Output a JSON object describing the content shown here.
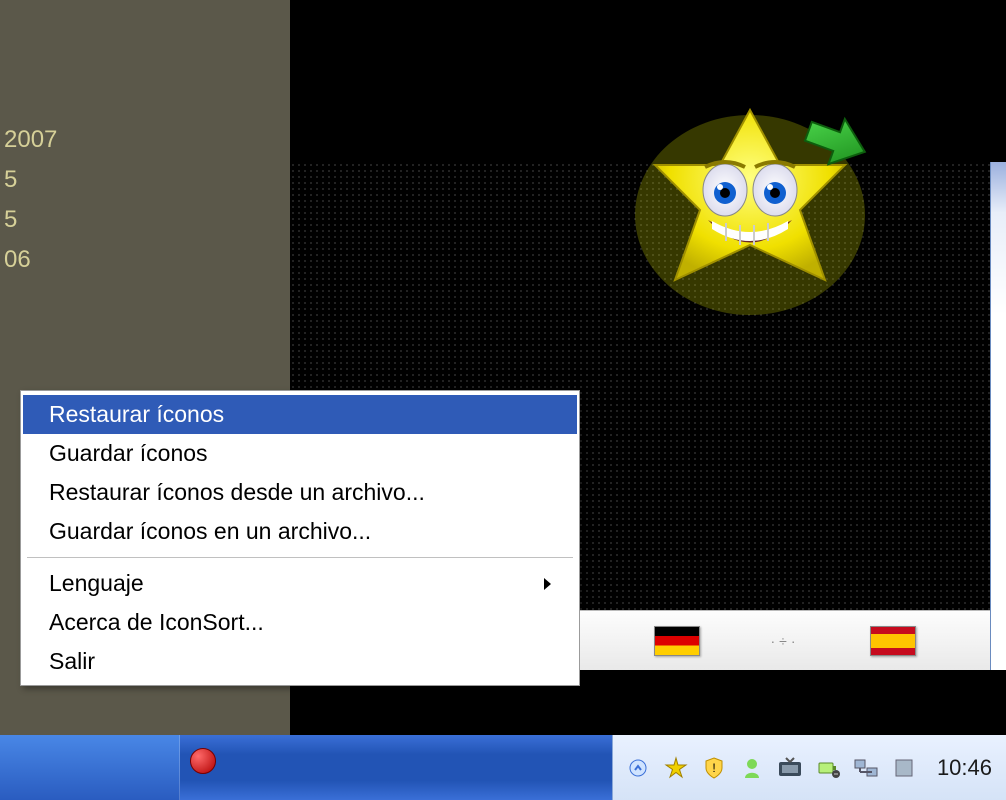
{
  "left_panel": {
    "lines": [
      "2007",
      "5",
      "5",
      "06"
    ]
  },
  "menu": {
    "restore": "Restaurar íconos",
    "save": "Guardar íconos",
    "restore_file": "Restaurar íconos desde un archivo...",
    "save_file": "Guardar íconos en un archivo...",
    "language": "Lenguaje",
    "about": "Acerca de IconSort...",
    "exit": "Salir"
  },
  "flags": {
    "germany": "germany-flag",
    "spain": "spain-flag"
  },
  "tray": {
    "clock": "10:46"
  }
}
